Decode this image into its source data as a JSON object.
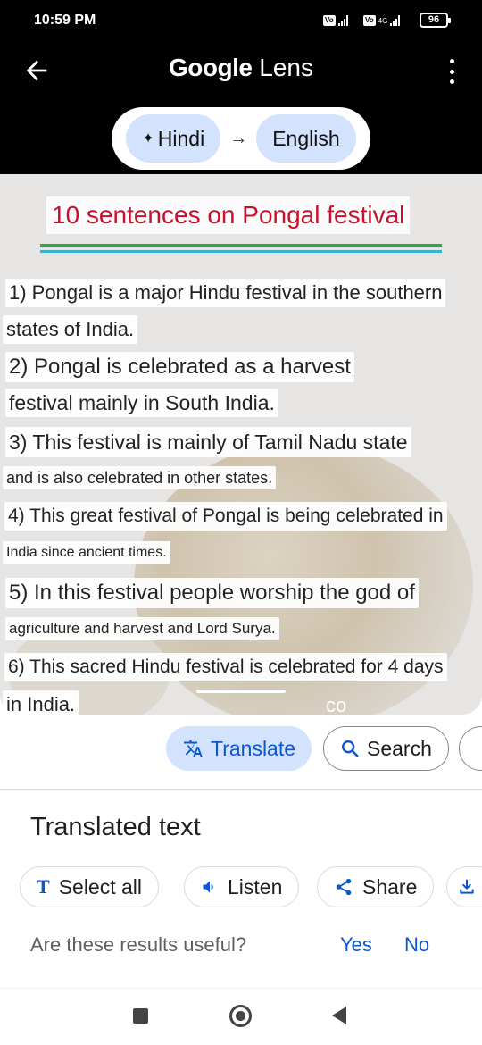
{
  "status_bar": {
    "time": "10:59 PM",
    "volte": "Vo LTE",
    "network": "4G",
    "battery": "96"
  },
  "app_bar": {
    "title_google": "Google",
    "title_lens": "Lens"
  },
  "language": {
    "source": "Hindi",
    "target": "English",
    "arrow": "→",
    "sparkle": "✦"
  },
  "image_text": {
    "title": "10 sentences on Pongal festival",
    "lines": [
      "1) Pongal is a major Hindu festival in the southern",
      "states of India.",
      "2) Pongal is celebrated as a harvest",
      "festival mainly in South India.",
      "3) This festival is mainly of Tamil Nadu state",
      "and is also celebrated in other states.",
      "4) This great festival of Pongal is being celebrated in",
      "India since ancient times.",
      "5) In this festival people worship the god of",
      "agriculture and harvest and Lord Surya.",
      "6) This sacred Hindu festival is celebrated for 4 days",
      "in India."
    ],
    "watermark": "co"
  },
  "mode_chips": {
    "translate": "Translate",
    "search": "Search"
  },
  "sheet": {
    "title": "Translated text",
    "select_all": "Select all",
    "listen": "Listen",
    "share": "Share",
    "useful_question": "Are these results useful?",
    "yes": "Yes",
    "no": "No"
  },
  "colors": {
    "accent": "#0b57d0",
    "chip_bg": "#d3e3fd",
    "title_red": "#c8102e"
  }
}
